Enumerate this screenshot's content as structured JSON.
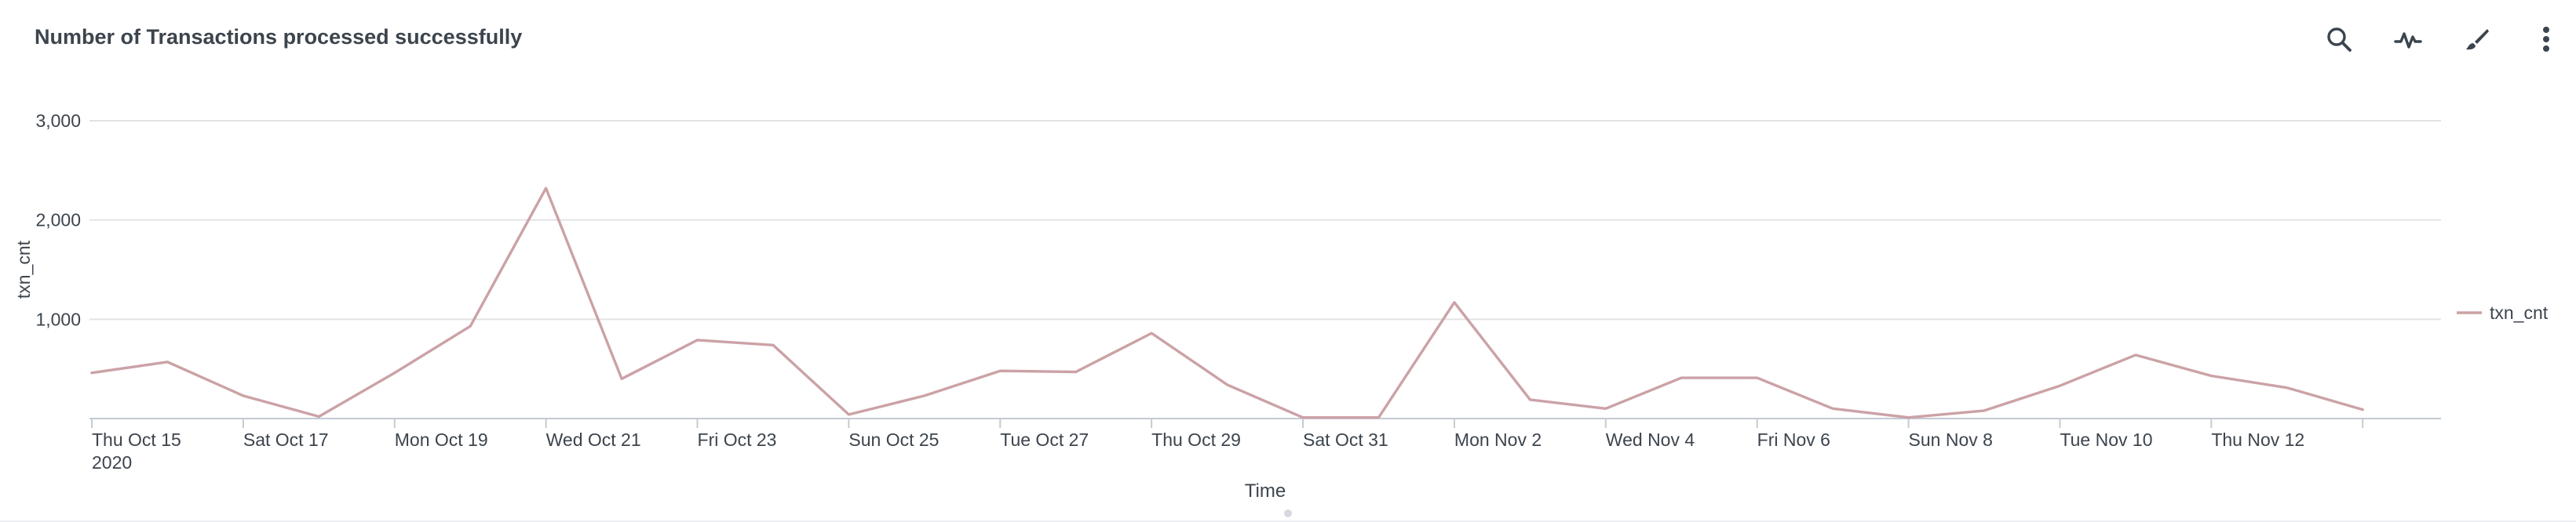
{
  "panel": {
    "title": "Number of Transactions processed successfully"
  },
  "toolbar": {
    "buttons": [
      {
        "name": "search-icon",
        "label": "Search"
      },
      {
        "name": "pulse-icon",
        "label": "Show Open in Search"
      },
      {
        "name": "paintbrush-icon",
        "label": "Format"
      },
      {
        "name": "more-vertical-icon",
        "label": "More actions"
      }
    ]
  },
  "colors": {
    "series": "#cba2a6",
    "grid": "#e1e3e6",
    "axis": "#c3cbd4",
    "text": "#3c444d"
  },
  "chart_data": {
    "type": "line",
    "title": "Number of Transactions processed successfully",
    "xlabel": "Time",
    "ylabel": "txn_cnt",
    "ylim": [
      0,
      3000
    ],
    "yticks": [
      1000,
      2000,
      3000
    ],
    "ytick_labels": [
      "1,000",
      "2,000",
      "3,000"
    ],
    "grid": true,
    "legend_position": "right",
    "x_tick_labels": [
      "Thu Oct 15",
      "Sat Oct 17",
      "Mon Oct 19",
      "Wed Oct 21",
      "Fri Oct 23",
      "Sun Oct 25",
      "Tue Oct 27",
      "Thu Oct 29",
      "Sat Oct 31",
      "Mon Nov 2",
      "Wed Nov 4",
      "Fri Nov 6",
      "Sun Nov 8",
      "Tue Nov 10",
      "Thu Nov 12"
    ],
    "x_year_label": "2020",
    "x": [
      "2020-10-15",
      "2020-10-16",
      "2020-10-17",
      "2020-10-18",
      "2020-10-19",
      "2020-10-20",
      "2020-10-21",
      "2020-10-22",
      "2020-10-23",
      "2020-10-24",
      "2020-10-25",
      "2020-10-26",
      "2020-10-27",
      "2020-10-28",
      "2020-10-29",
      "2020-10-30",
      "2020-10-31",
      "2020-11-01",
      "2020-11-02",
      "2020-11-03",
      "2020-11-04",
      "2020-11-05",
      "2020-11-06",
      "2020-11-07",
      "2020-11-08",
      "2020-11-09",
      "2020-11-10",
      "2020-11-11",
      "2020-11-12",
      "2020-11-13",
      "2020-11-14",
      "2020-11-15"
    ],
    "series": [
      {
        "name": "txn_cnt",
        "color": "#cba2a6",
        "values": [
          460,
          570,
          230,
          20,
          460,
          930,
          2320,
          400,
          790,
          740,
          40,
          230,
          480,
          470,
          860,
          340,
          10,
          10,
          1170,
          190,
          100,
          410,
          410,
          100,
          10,
          80,
          330,
          640,
          430,
          310,
          90,
          null
        ]
      }
    ]
  }
}
